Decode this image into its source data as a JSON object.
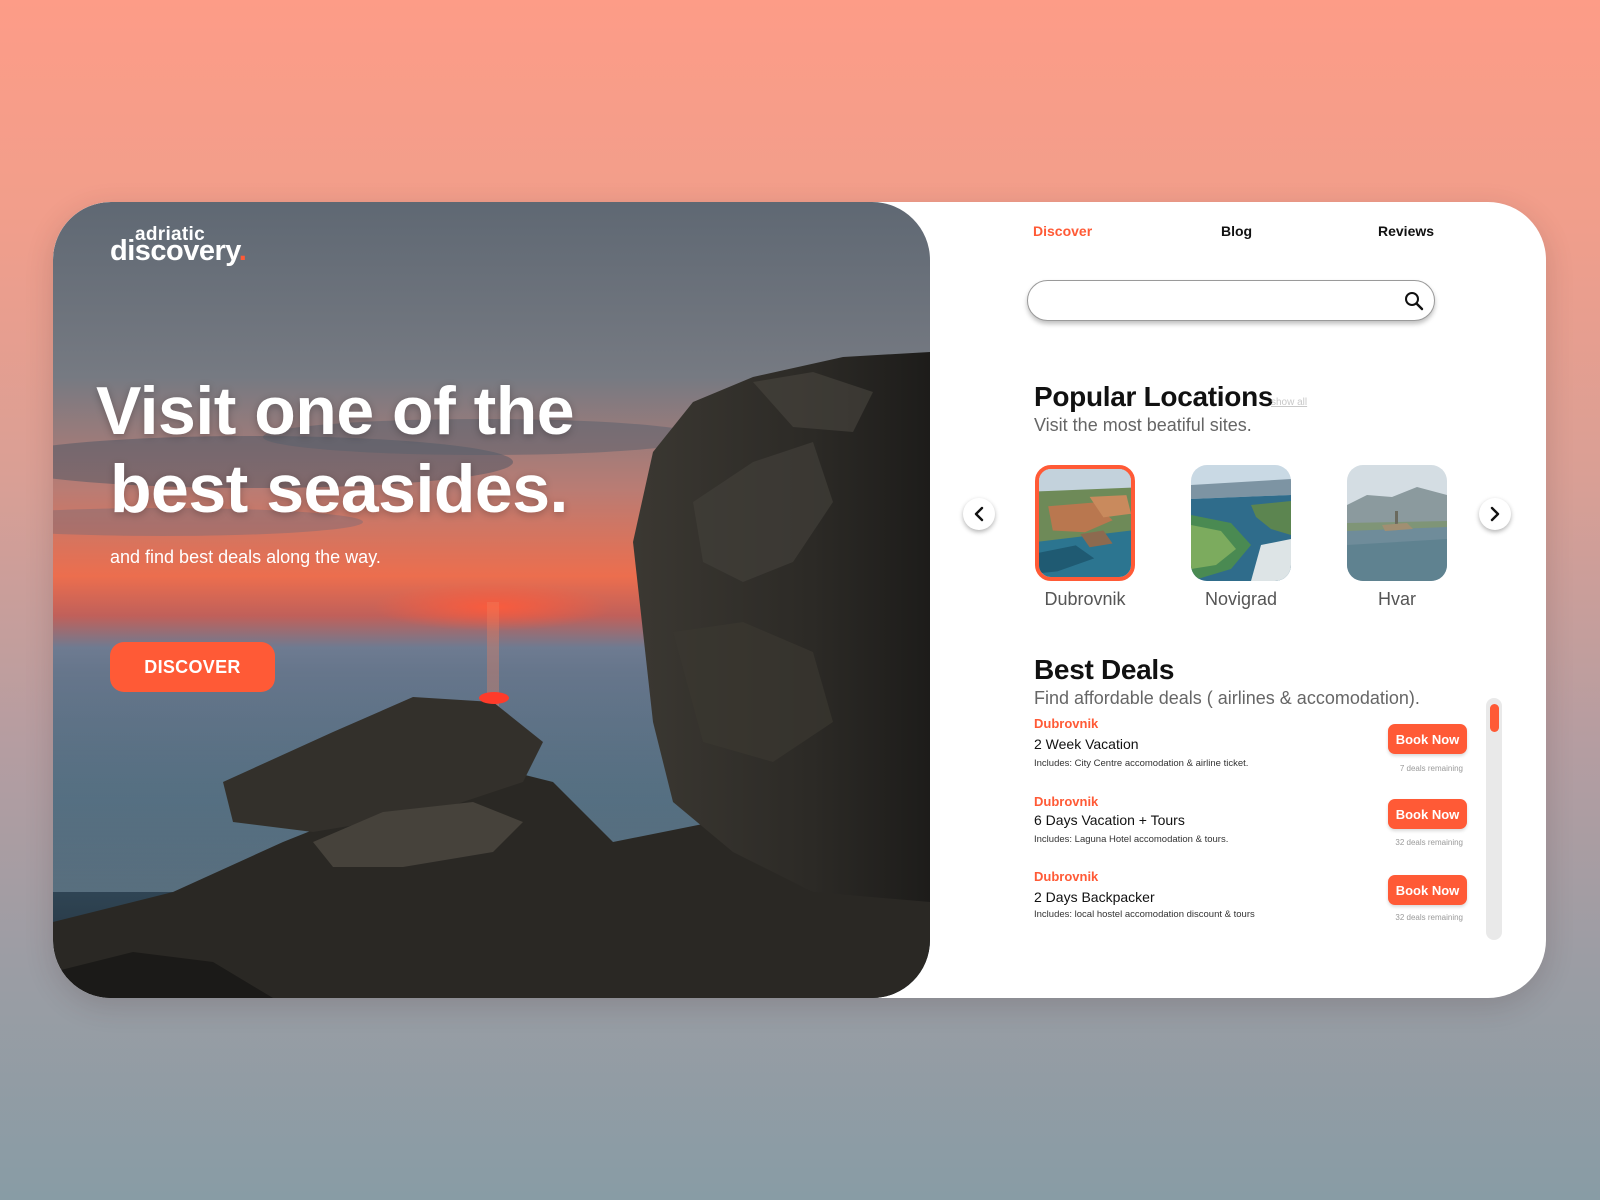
{
  "brand": {
    "top": "adriatic",
    "main": "discovery",
    "dot": ".",
    "accent_color": "#ff5a36"
  },
  "hero": {
    "title_line1": "Visit one of the",
    "title_line2": "best seasides.",
    "subtitle": "and find best deals along the way.",
    "cta_label": "DISCOVER"
  },
  "nav": {
    "items": [
      {
        "label": "Discover",
        "active": true
      },
      {
        "label": "Blog",
        "active": false
      },
      {
        "label": "Reviews",
        "active": false
      }
    ]
  },
  "search": {
    "value": "",
    "placeholder": "",
    "icon": "search-icon"
  },
  "popular": {
    "title": "Popular Locations",
    "show_all": "show all",
    "subtitle": "Visit the most beatiful sites.",
    "prev_icon": "chevron-left-icon",
    "next_icon": "chevron-right-icon",
    "locations": [
      {
        "name": "Dubrovnik",
        "selected": true
      },
      {
        "name": "Novigrad",
        "selected": false
      },
      {
        "name": "Hvar",
        "selected": false
      }
    ]
  },
  "deals": {
    "title": "Best Deals",
    "subtitle": "Find affordable deals ( airlines & accomodation).",
    "items": [
      {
        "city": "Dubrovnik",
        "title": "2 Week Vacation",
        "includes": "Includes: City Centre accomodation & airline ticket.",
        "button": "Book Now",
        "remaining": "7 deals remaining"
      },
      {
        "city": "Dubrovnik",
        "title": "6 Days Vacation + Tours",
        "includes": "Includes: Laguna Hotel accomodation &  tours.",
        "button": "Book Now",
        "remaining": "32 deals remaining"
      },
      {
        "city": "Dubrovnik",
        "title": "2 Days Backpacker",
        "includes": "Includes: local hostel accomodation discount & tours",
        "button": "Book Now",
        "remaining": "32 deals remaining"
      }
    ]
  }
}
